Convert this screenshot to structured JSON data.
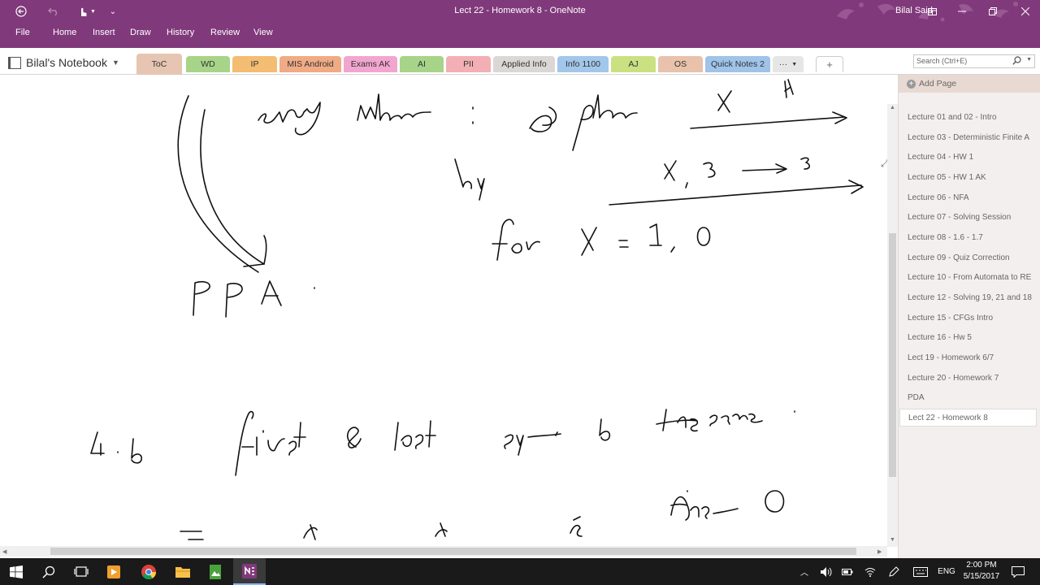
{
  "window": {
    "title": "Lect 22 - Homework 8  -  OneNote",
    "user": "Bilal Said"
  },
  "ribbon": {
    "tabs": [
      "File",
      "Home",
      "Insert",
      "Draw",
      "History",
      "Review",
      "View"
    ]
  },
  "notebook": {
    "name": "Bilal's Notebook"
  },
  "sections": [
    {
      "label": "ToC",
      "color": "#e6c5b2"
    },
    {
      "label": "WD",
      "color": "#a7d489"
    },
    {
      "label": "IP",
      "color": "#f3bd73"
    },
    {
      "label": "MIS Android",
      "color": "#f0ab85"
    },
    {
      "label": "Exams AK",
      "color": "#f2a6cf"
    },
    {
      "label": "AI",
      "color": "#a7d489"
    },
    {
      "label": "PII",
      "color": "#f2b0b5"
    },
    {
      "label": "Applied Info",
      "color": "#dbd7d6"
    },
    {
      "label": "Info 1100",
      "color": "#a2c7ea"
    },
    {
      "label": "AJ",
      "color": "#cbe181"
    },
    {
      "label": "OS",
      "color": "#e8c2aa"
    },
    {
      "label": "Quick Notes 2",
      "color": "#9fc3e9"
    }
  ],
  "section_more": "···",
  "section_add": "+",
  "search": {
    "placeholder": "Search (Ctrl+E)"
  },
  "page_list": {
    "add_label": "Add Page",
    "pages": [
      "Lecture 01 and 02 - Intro",
      "Lecture 03 - Deterministic Finite A",
      "Lecture 04 - HW 1",
      "Lecture 05 - HW 1 AK",
      "Lecture 06 - NFA",
      "Lecture 07 - Solving Session",
      "Lecture 08 - 1.6 - 1.7",
      "Lecture 09 - Quiz Correction",
      "Lecture 10 - From Automata to RE",
      "Lecture 12 - Solving 19, 21 and 18",
      "Lecture 15 - CFGs Intro",
      "Lecture 16 - Hw 5",
      "Lect 19 - Homework 6/7",
      "Lecture 20 - Homework 7",
      "PDA",
      "Lect 22 - Homework 8"
    ],
    "selected_index": 15
  },
  "colors": {
    "accent": "#80397b",
    "taskbar": "#1a1a1a"
  },
  "taskbar": {
    "apps": [
      "windows-start-icon",
      "search-icon",
      "task-view-icon",
      "media-player-icon",
      "chrome-icon",
      "file-explorer-icon",
      "photos-icon",
      "onenote-icon"
    ],
    "language": "ENG",
    "time": "2:00 PM",
    "date": "5/15/2017"
  }
}
